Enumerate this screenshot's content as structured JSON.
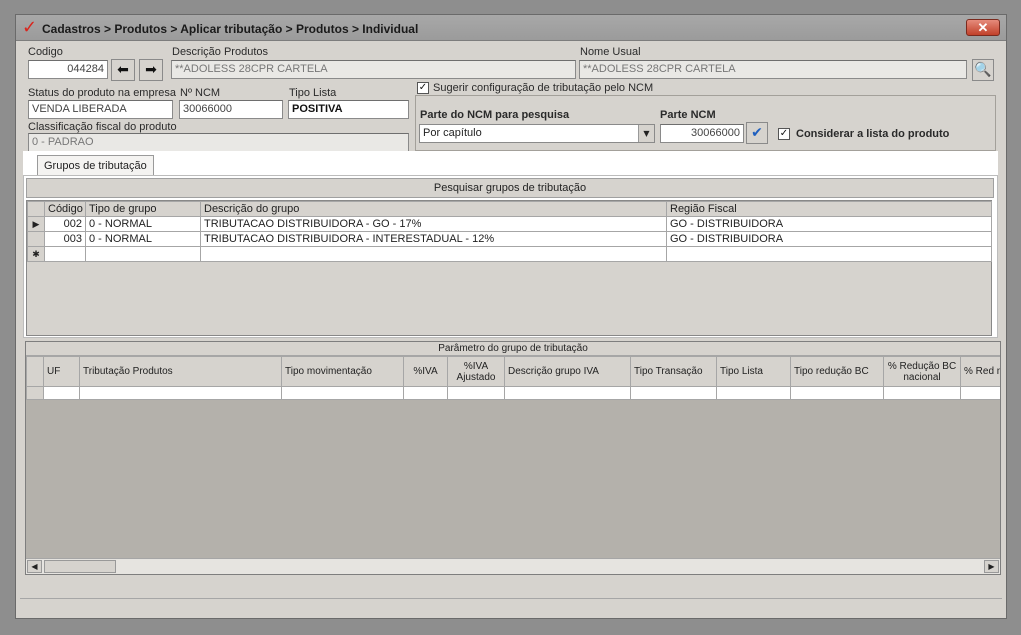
{
  "window": {
    "title": "Cadastros > Produtos > Aplicar tributação > Produtos > Individual",
    "close_label": "✕"
  },
  "form": {
    "codigo_label": "Codigo",
    "codigo_value": "044284",
    "descricao_label": "Descrição Produtos",
    "descricao_value": "**ADOLESS 28CPR CARTELA",
    "nome_usual_label": "Nome Usual",
    "nome_usual_value": "**ADOLESS 28CPR CARTELA",
    "status_label": "Status do produto na empresa",
    "status_value": "VENDA LIBERADA",
    "ncm_label": "Nº NCM",
    "ncm_value": "30066000",
    "tipo_lista_label": "Tipo Lista",
    "tipo_lista_value": "POSITIVA",
    "classificacao_label": "Classificação fiscal do produto",
    "classificacao_value": "0 - PADRAO"
  },
  "ncm_box": {
    "sugerir_label": "Sugerir configuração de tributação pelo NCM",
    "sugerir_checked": "✓",
    "parte_ncm_pesquisa_label": "Parte do NCM para pesquisa",
    "parte_ncm_pesquisa_value": "Por capítulo",
    "parte_ncm_label": "Parte NCM",
    "parte_ncm_value": "30066000",
    "considerar_label": "Considerar a lista do produto",
    "considerar_checked": "✓"
  },
  "tabs": [
    {
      "label": "Grupos de tributação"
    }
  ],
  "groups": {
    "search_button": "Pesquisar grupos de tributação",
    "columns": [
      "Código",
      "Tipo de grupo",
      "Descrição do grupo",
      "Região Fiscal"
    ],
    "rows": [
      {
        "codigo": "002",
        "tipo": "0 - NORMAL",
        "descricao": "TRIBUTACAO DISTRIBUIDORA - GO - 17%",
        "regiao": "GO - DISTRIBUIDORA"
      },
      {
        "codigo": "003",
        "tipo": "0 - NORMAL",
        "descricao": "TRIBUTACAO DISTRIBUIDORA - INTERESTADUAL - 12%",
        "regiao": "GO - DISTRIBUIDORA"
      }
    ],
    "current_row_marker": "▶",
    "new_row_marker": "✱"
  },
  "params": {
    "title": "Parâmetro do grupo de tributação",
    "columns": [
      "UF",
      "Tributação Produtos",
      "Tipo movimentação",
      "%IVA",
      "%IVA Ajustado",
      "Descrição grupo IVA",
      "Tipo Transação",
      "Tipo Lista",
      "Tipo redução BC",
      "% Redução BC nacional",
      "% Red nac"
    ]
  },
  "icons": {
    "back": "arrow-left-icon",
    "forward": "arrow-right-icon",
    "search": "magnifier-icon",
    "confirm": "checkmark-icon"
  }
}
